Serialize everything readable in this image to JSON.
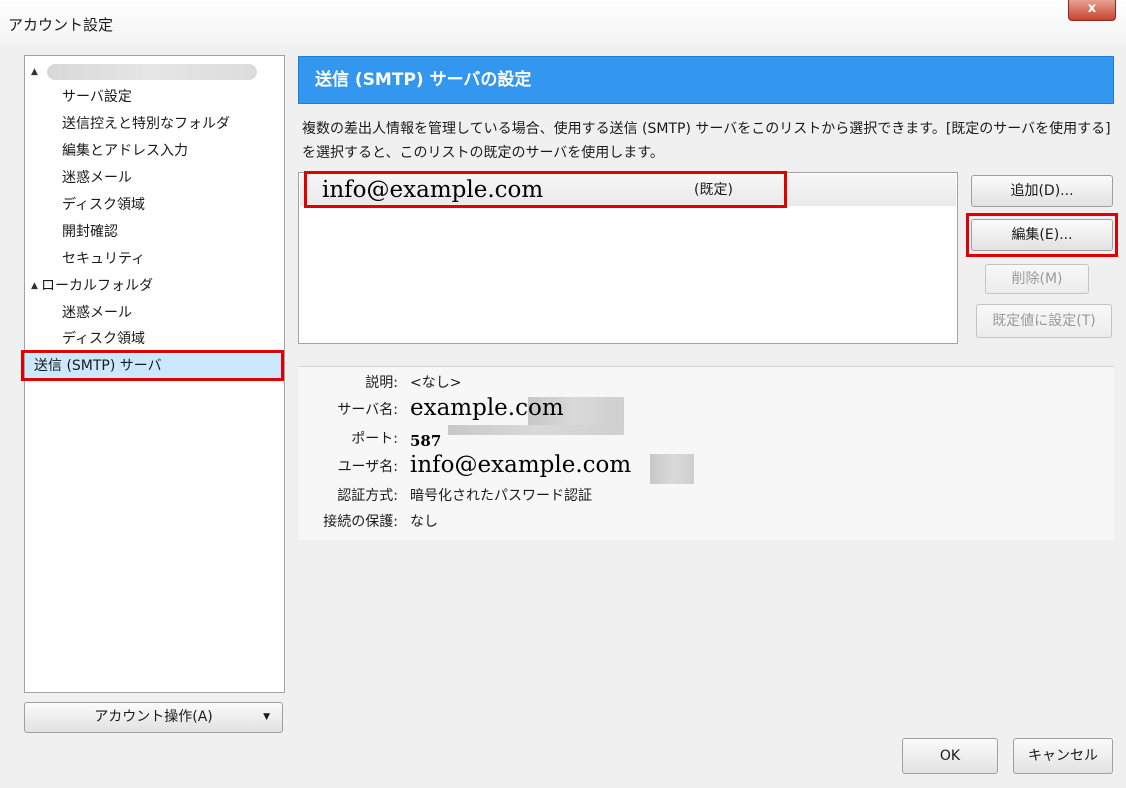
{
  "window": {
    "title": "アカウント設定",
    "close_label": "x"
  },
  "tree": {
    "items": [
      {
        "label": "サーバ設定"
      },
      {
        "label": "送信控えと特別なフォルダ"
      },
      {
        "label": "編集とアドレス入力"
      },
      {
        "label": "迷惑メール"
      },
      {
        "label": "ディスク領域"
      },
      {
        "label": "開封確認"
      },
      {
        "label": "セキュリティ"
      },
      {
        "label": "ローカルフォルダ"
      },
      {
        "label": "迷惑メール"
      },
      {
        "label": "ディスク領域"
      },
      {
        "label": "送信 (SMTP) サーバ"
      }
    ],
    "expand_icon": "▲",
    "account_actions_label": "アカウント操作(A)",
    "account_actions_caret": "▼"
  },
  "main": {
    "heading": "送信 (SMTP) サーバの設定",
    "description": "複数の差出人情報を管理している場合、使用する送信 (SMTP) サーバをこのリストから選択できます。[既定のサーバを使用する] を選択すると、このリストの既定のサーバを使用します。",
    "servers": [
      {
        "name": "info@example.com",
        "badge": "(既定)"
      }
    ],
    "buttons": {
      "add": "追加(D)...",
      "edit": "編集(E)...",
      "delete": "削除(M)",
      "set_default": "既定値に設定(T)"
    },
    "details": {
      "description_label": "説明:",
      "description_value": "<なし>",
      "server_label": "サーバ名:",
      "server_value": "example.com",
      "port_label": "ポート:",
      "port_value": "587",
      "user_label": "ユーザ名:",
      "user_value": "info@example.com",
      "auth_label": "認証方式:",
      "auth_value": "暗号化されたパスワード認証",
      "security_label": "接続の保護:",
      "security_value": "なし"
    }
  },
  "footer": {
    "ok": "OK",
    "cancel": "キャンセル"
  },
  "colors": {
    "banner": "#3396ef",
    "highlight": "#e00000",
    "selected_row": "#cce8ff"
  }
}
